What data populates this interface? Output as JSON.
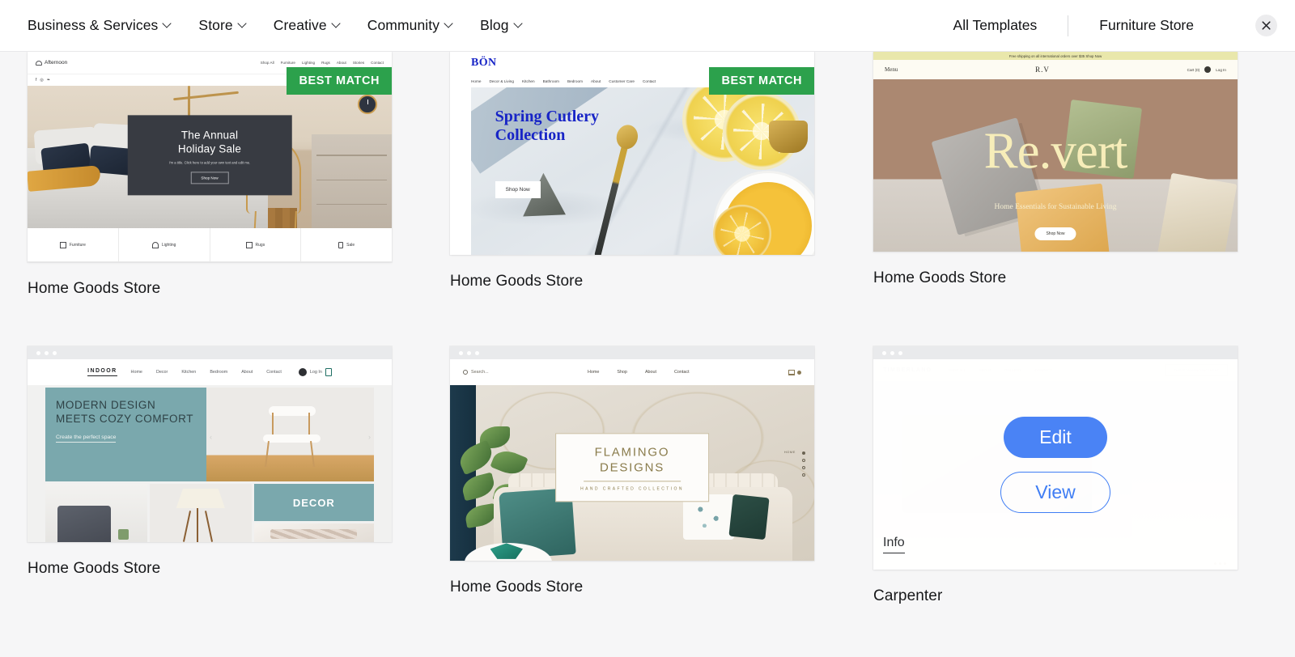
{
  "header": {
    "nav_items": [
      {
        "label": "Business & Services",
        "has_chevron": true
      },
      {
        "label": "Store",
        "has_chevron": true
      },
      {
        "label": "Creative",
        "has_chevron": true
      },
      {
        "label": "Community",
        "has_chevron": true
      },
      {
        "label": "Blog",
        "has_chevron": true
      }
    ],
    "all_templates_label": "All Templates",
    "current_category": "Furniture Store",
    "close_icon": "close-icon"
  },
  "badges": {
    "best_match": "BEST MATCH",
    "color": "#2ca14c"
  },
  "cards": [
    {
      "title": "Home Goods Store",
      "badge": "BEST MATCH",
      "template": {
        "logo": "Afternoon",
        "nav": [
          "Shop All",
          "Furniture",
          "Lighting",
          "Rugs",
          "About",
          "Stories",
          "Contact"
        ],
        "social": [
          "f",
          "◎",
          "❧"
        ],
        "hero_title_line1": "The Annual",
        "hero_title_line2": "Holiday Sale",
        "hero_paragraph": "I'm a title. Click here to add your own text and edit me.",
        "hero_button": "Shop Now",
        "categories": [
          "Furniture",
          "Lighting",
          "Rugs",
          "Sale"
        ]
      }
    },
    {
      "title": "Home Goods Store",
      "badge": "BEST MATCH",
      "template": {
        "logo": "BÖN",
        "nav": [
          "Home",
          "Decor & Living",
          "Kitchen",
          "Bathroom",
          "Bedroom",
          "About",
          "Customer Care",
          "Contact"
        ],
        "hero_title_line1": "Spring Cutlery",
        "hero_title_line2": "Collection",
        "hero_button": "Shop Now"
      }
    },
    {
      "title": "Home Goods Store",
      "badge": null,
      "template": {
        "announcement": "Free shipping on all international orders over $35 Shop Now",
        "menu_label": "Menu",
        "brand_mark": "R.V",
        "cart_label": "Cart (0)",
        "login_label": "Log In",
        "hero_title": "Re.vert",
        "hero_subtitle": "Home Essentials for Sustainable Living",
        "hero_button": "Shop Now"
      }
    },
    {
      "title": "Home Goods Store",
      "badge": null,
      "template": {
        "logo": "INDOOR",
        "nav": [
          "Home",
          "Decor",
          "Kitchen",
          "Bedroom",
          "About",
          "Contact"
        ],
        "login_label": "Log In",
        "hero_title": "MODERN DESIGN MEETS COZY COMFORT",
        "hero_link": "Create the perfect space",
        "tile_label": "DECOR"
      }
    },
    {
      "title": "Home Goods Store",
      "badge": null,
      "template": {
        "search_placeholder": "Search...",
        "nav": [
          "Home",
          "Shop",
          "About",
          "Contact"
        ],
        "sign_line1": "FLAMINGO",
        "sign_line2": "DESIGNS",
        "sign_sub": "HAND CRAFTED COLLECTION",
        "side_nav_label": "HOME"
      }
    },
    {
      "title": "Carpenter",
      "badge": null,
      "hovered": true,
      "actions": {
        "edit": "Edit",
        "view": "View",
        "info": "Info"
      },
      "template": {
        "logo": "TIMBERLAND",
        "nav": [
          "SHOP ALL",
          "ABOUT",
          "GALLERY",
          "CONTACT"
        ],
        "cta": "THIS IS AN ANNOUNCEMENT"
      }
    }
  ],
  "theme": {
    "page_background": "#f6f6f7",
    "card_background": "#ffffff",
    "accent_blue": "#4a83f5",
    "badge_green": "#2ca14c",
    "text_primary": "#17181a"
  }
}
